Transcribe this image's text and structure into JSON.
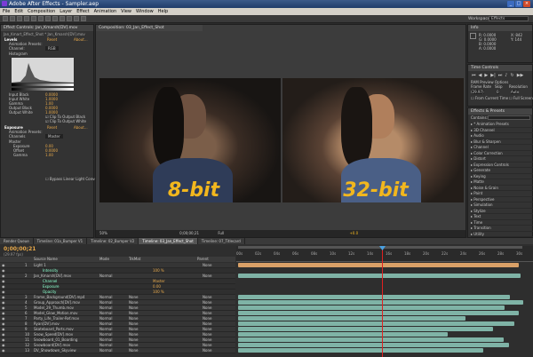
{
  "window": {
    "title": "Adobe After Effects - Sampler.aep"
  },
  "menu": [
    "File",
    "Edit",
    "Composition",
    "Layer",
    "Effect",
    "Animation",
    "View",
    "Window",
    "Help"
  ],
  "workspace": {
    "label": "Workspace:",
    "value": "Effects"
  },
  "effects_panel": {
    "tab": "Effect Controls: Jan_Kmarsh[DV].mov",
    "subtitle": "Jan_Kmart_Effect_Shot * Jan_Kmarsh[DV].mov",
    "levels": "Levels",
    "reset": "Reset",
    "about": "About...",
    "animation_presets": "Animation Presets:",
    "channel": "Channel:",
    "channel_val": "RGB",
    "histogram": "Histogram",
    "input_black": "Input Black",
    "input_black_val": "0.0000",
    "input_white": "Input White",
    "input_white_val": "1.0000",
    "gamma": "Gamma",
    "gamma_val": "1.00",
    "output_black": "Output Black",
    "output_black_val": "0.0000",
    "output_white": "Output White",
    "output_white_val": "1.0000",
    "clip_black": "Clip To Output Black",
    "clip_white": "Clip To Output White",
    "exposure": "Exposure",
    "channels": "Channels",
    "channels_val": "Master",
    "master": "Master",
    "exposure_p": "Exposure",
    "exposure_val": "0.00",
    "offset": "Offset",
    "offset_val": "0.0000",
    "gamma2": "Gamma",
    "gamma2_val": "1.00",
    "bypass": "Bypass Linear Light Conversion"
  },
  "viewer": {
    "tab": "Composition: 03_Jan_Effect_Shot",
    "left_label": "8-bit",
    "right_label": "32-bit",
    "zoom": "50%",
    "time": "0;00;00;21",
    "res": "Full",
    "bpc": "+0.0"
  },
  "info_panel": {
    "tab": "Info",
    "r": "R: 0.0000",
    "g": "G: 0.0000",
    "b": "B: 0.0000",
    "a": "A: 0.0000",
    "x": "X: 842",
    "y": "Y: 144"
  },
  "time_controls": {
    "tab": "Time Controls",
    "ram": "RAM Preview Options",
    "frame_rate": "Frame Rate",
    "skip": "Skip",
    "resolution": "Resolution",
    "fr_val": "(29.97)",
    "skip_val": "0",
    "res_val": "Auto",
    "from_current": "From Current Time",
    "full_screen": "Full Screen"
  },
  "effects_presets": {
    "tab": "Effects & Presets",
    "contains": "Contains:",
    "items": [
      "* Animation Presets",
      "3D Channel",
      "Audio",
      "Blur & Sharpen",
      "Channel",
      "Color Correction",
      "Distort",
      "Expression Controls",
      "Generate",
      "Keying",
      "Matte",
      "Noise & Grain",
      "Paint",
      "Perspective",
      "Simulation",
      "Stylize",
      "Text",
      "Time",
      "Transition",
      "Utility"
    ]
  },
  "timeline": {
    "tabs": [
      "Render Queue",
      "Timeline: 01a_Bumper V1",
      "Timeline: 02_Bumper V2",
      "Timeline: 03_Jan_Effect_Shot",
      "Timeline: 07_Titlecard"
    ],
    "timecode": "0;00;00;21",
    "fps": "(29.97 fps)",
    "cols": {
      "source": "Source Name",
      "mode": "Mode",
      "trkmat": "TrkMat",
      "parent": "Parent"
    },
    "ruler": [
      "00s",
      "02s",
      "04s",
      "06s",
      "08s",
      "10s",
      "12s",
      "14s",
      "16s",
      "18s",
      "20s",
      "22s",
      "24s",
      "26s",
      "28s",
      "30s"
    ],
    "layers": [
      {
        "num": "1",
        "name": "Light 1",
        "mode": "",
        "trk": "",
        "parent": "None",
        "top": true
      },
      {
        "num": "",
        "name": "Intensity",
        "mode": "",
        "trk": "",
        "parent": "",
        "val": "100 %"
      },
      {
        "num": "2",
        "name": "Jan_Kmarsh[DV].mov",
        "mode": "Normal",
        "trk": "",
        "parent": "None"
      },
      {
        "num": "",
        "name": "Channel",
        "mode": "",
        "trk": "",
        "parent": "",
        "val": "Master"
      },
      {
        "num": "",
        "name": "Exposure",
        "mode": "",
        "trk": "",
        "parent": "",
        "val": "0.00"
      },
      {
        "num": "",
        "name": "Opacity",
        "mode": "",
        "trk": "",
        "parent": "",
        "val": "100 %"
      },
      {
        "num": "3",
        "name": "Frame_Background[DV].mp4",
        "mode": "Normal",
        "trk": "None",
        "parent": "None"
      },
      {
        "num": "4",
        "name": "Group_Approach[DV].mov",
        "mode": "Normal",
        "trk": "None",
        "parent": "None"
      },
      {
        "num": "5",
        "name": "Model_29_Thumb.mov",
        "mode": "Normal",
        "trk": "None",
        "parent": "None"
      },
      {
        "num": "6",
        "name": "Model_Glow_Motion.mov",
        "mode": "Normal",
        "trk": "None",
        "parent": "None"
      },
      {
        "num": "7",
        "name": "Party_Life_Trailer-Ref.mov",
        "mode": "Normal",
        "trk": "None",
        "parent": "None"
      },
      {
        "num": "8",
        "name": "Ryan[DV].mov",
        "mode": "Normal",
        "trk": "None",
        "parent": "None"
      },
      {
        "num": "9",
        "name": "Skateboard_Parts.mov",
        "mode": "Normal",
        "trk": "None",
        "parent": "None"
      },
      {
        "num": "10",
        "name": "Snow_Speed[DV].mov",
        "mode": "Normal",
        "trk": "None",
        "parent": "None"
      },
      {
        "num": "11",
        "name": "Snowboard_01_Boarding",
        "mode": "Normal",
        "trk": "None",
        "parent": "None"
      },
      {
        "num": "12",
        "name": "Snowboard[DV].mov",
        "mode": "Normal",
        "trk": "None",
        "parent": "None"
      },
      {
        "num": "13",
        "name": "DV_Showdown_Skyview",
        "mode": "Normal",
        "trk": "None",
        "parent": "None"
      }
    ]
  },
  "colors": {
    "accent": "#f2b71e",
    "track": "#7fb3a6",
    "light": "#d9a067",
    "playhead": "#e02020"
  }
}
